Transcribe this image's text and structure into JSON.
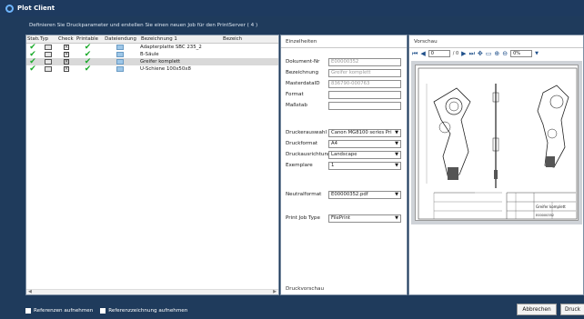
{
  "window": {
    "title": "Plot Client"
  },
  "instruction": "Definieren Sie Druckparameter und erstellen Sie einen neuen Job für den PrintServer  ( 4 )",
  "table": {
    "columns": [
      "Status",
      "Typ",
      "Check",
      "Printable",
      "Dateiendung",
      "Bezeichnung 1",
      "Bezeich"
    ],
    "rows": [
      {
        "bezeichnung": "Adapterplatte SBC 235_2",
        "selected": false
      },
      {
        "bezeichnung": "B-Säule",
        "selected": false
      },
      {
        "bezeichnung": "Greifer komplett",
        "selected": true
      },
      {
        "bezeichnung": "U-Schiene 100x50x8",
        "selected": false
      }
    ],
    "check_mark": "✔",
    "x_mark": "×"
  },
  "details": {
    "title": "Einzelheiten",
    "fields": {
      "dokument_nr": {
        "label": "Dokument-Nr",
        "value": "E00000352"
      },
      "bezeichnung": {
        "label": "Bezeichnung",
        "value": "Greifer komplett"
      },
      "masterdataid": {
        "label": "MasterdataID",
        "value": "836790-000763"
      },
      "format": {
        "label": "Format",
        "value": ""
      },
      "massstab": {
        "label": "Maßstab",
        "value": ""
      },
      "druckerauswahl": {
        "label": "Druckerauswahl",
        "value": "Canon MG8100 series Pri"
      },
      "druckformat": {
        "label": "Druckformat",
        "value": "A4"
      },
      "druckausrichtung": {
        "label": "Druckausrichtung",
        "value": "Landscape"
      },
      "exemplare": {
        "label": "Exemplare",
        "value": "1"
      },
      "neutralformat": {
        "label": "Neutralformat",
        "value": "E00000352.pdf"
      },
      "printjobtype": {
        "label": "Print Job Type",
        "value": "FilePrint"
      }
    },
    "footer": "Druckvorschau"
  },
  "preview": {
    "title": "Vorschau",
    "page_value": "0",
    "page_sep": "/ 0",
    "zoom_value": "0%",
    "drawing_title": "Greifer komplett",
    "drawing_number": "E00000352"
  },
  "bottom": {
    "checkbox1": "Referenzen aufnehmen",
    "checkbox2": "Referenzzeichnung aufnehmen",
    "cancel": "Abbrechen",
    "print": "Druck"
  },
  "colors": {
    "titlebar": "#1e3a5f",
    "accent": "#1e4f8a",
    "check_green": "#1aaa2a"
  }
}
